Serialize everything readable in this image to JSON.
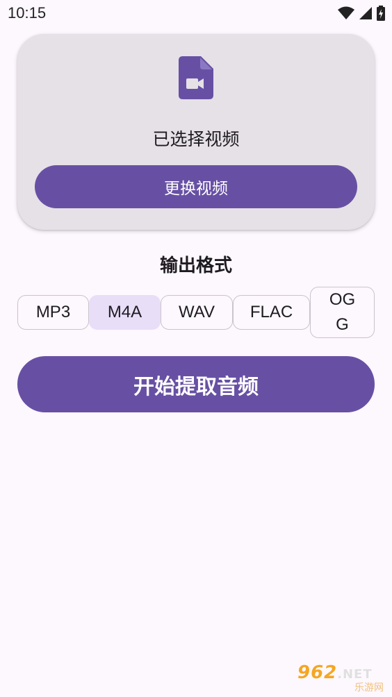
{
  "status_bar": {
    "time": "10:15"
  },
  "card": {
    "status_text": "已选择视频",
    "change_button_label": "更换视频"
  },
  "format_section": {
    "title": "输出格式",
    "options": [
      "MP3",
      "M4A",
      "WAV",
      "FLAC",
      "OGG"
    ],
    "selected": "M4A"
  },
  "extract_button_label": "开始提取音频",
  "watermark": {
    "brand": "962",
    "suffix": ".NET",
    "subtitle": "乐游网"
  },
  "colors": {
    "primary": "#6750a4",
    "card_bg": "#e6e1e6",
    "selected_chip": "#e8def8",
    "page_bg": "#fdf7fe"
  }
}
